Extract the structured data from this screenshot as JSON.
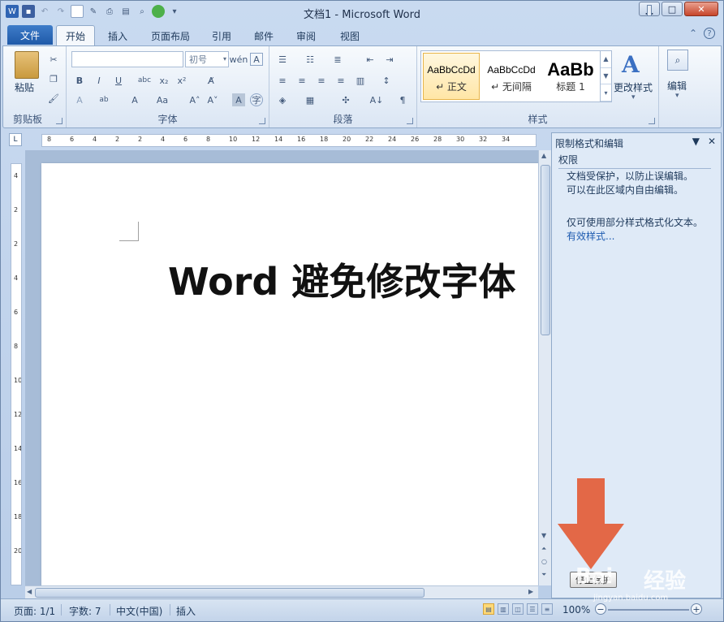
{
  "window": {
    "title": "文档1 - Microsoft Word",
    "controls": {
      "minimize": "▁",
      "maximize": "□",
      "close": "✕"
    }
  },
  "quick_access": [
    "word-logo-icon",
    "save-icon",
    "undo-icon",
    "redo-icon",
    "new-doc-icon",
    "edit-icon",
    "print-icon",
    "print-preview-icon",
    "find-icon",
    "globe-icon",
    "customize-qat-icon"
  ],
  "tabs": {
    "file": "文件",
    "items": [
      "开始",
      "插入",
      "页面布局",
      "引用",
      "邮件",
      "审阅",
      "视图"
    ],
    "active": "开始"
  },
  "ribbon": {
    "clipboard": {
      "paste": "粘贴",
      "label": "剪贴板"
    },
    "font": {
      "font_name": "",
      "font_size": "初号",
      "label": "字体"
    },
    "paragraph": {
      "label": "段落"
    },
    "styles": {
      "label": "样式",
      "items": [
        {
          "preview": "AaBbCcDd",
          "name": "↵ 正文"
        },
        {
          "preview": "AaBbCcDd",
          "name": "↵ 无间隔"
        },
        {
          "preview": "AaBb",
          "name": "标题 1"
        }
      ],
      "change_styles": "更改样式"
    },
    "editing": {
      "label": "编辑"
    }
  },
  "ruler": {
    "h_numbers": [
      "8",
      "6",
      "4",
      "2",
      "2",
      "4",
      "6",
      "8",
      "10",
      "12",
      "14",
      "16",
      "18",
      "20",
      "22",
      "24",
      "26",
      "28",
      "30",
      "32",
      "34"
    ],
    "v_numbers": [
      "4",
      "2",
      "2",
      "4",
      "6",
      "8",
      "10",
      "12",
      "14",
      "16",
      "18",
      "20"
    ]
  },
  "document": {
    "heading": "Word 避免修改字体"
  },
  "task_pane": {
    "title": "限制格式和编辑",
    "section": "权限",
    "line1": "文档受保护，以防止误编辑。",
    "line2": "可以在此区域内自由编辑。",
    "line3": "仅可使用部分样式格式化文本。",
    "link": "有效样式...",
    "stop_button": "停止保护"
  },
  "status_bar": {
    "page": "页面: 1/1",
    "words": "字数: 7",
    "language": "中文(中国)",
    "mode": "插入",
    "zoom": "100%"
  },
  "watermark": {
    "text1": "Bai",
    "text2": "经验",
    "url": "jingyan.baidu.com"
  },
  "colors": {
    "accent": "#1f5aa8",
    "arrow": "#e35c37"
  }
}
